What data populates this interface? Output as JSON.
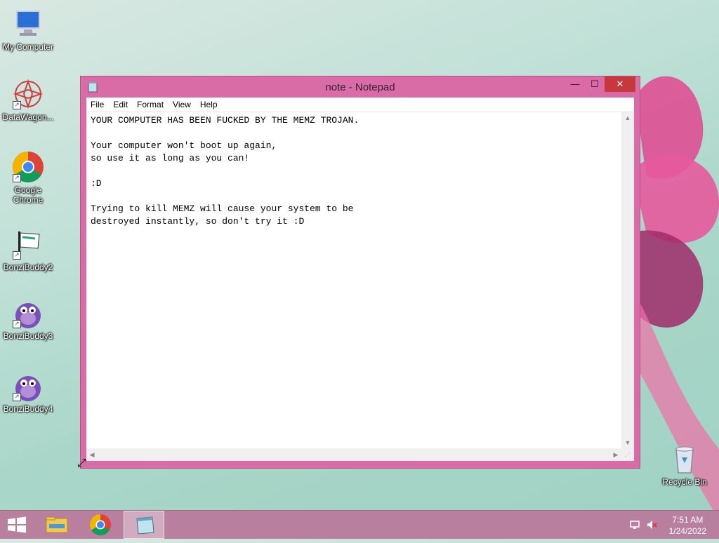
{
  "desktop": {
    "icons": [
      {
        "label": "My Computer",
        "icon": "computer-icon"
      },
      {
        "label": "DataWagon...",
        "icon": "datawagon-icon"
      },
      {
        "label": "Google Chrome",
        "icon": "chrome-icon"
      },
      {
        "label": "BonziBuddy2",
        "icon": "bonzi-flag-icon"
      },
      {
        "label": "BonziBuddy3",
        "icon": "bonzi-gorilla-icon"
      },
      {
        "label": "BonziBuddy4",
        "icon": "bonzi-gorilla-icon"
      },
      {
        "label": "Recycle Bin",
        "icon": "recycle-bin-icon"
      }
    ]
  },
  "window": {
    "title": "note - Notepad",
    "controls": {
      "minimize": "—",
      "maximize": "☐",
      "close": "✕"
    },
    "menu": [
      "File",
      "Edit",
      "Format",
      "View",
      "Help"
    ],
    "content": "YOUR COMPUTER HAS BEEN FUCKED BY THE MEMZ TROJAN.\n\nYour computer won't boot up again,\nso use it as long as you can!\n\n:D\n\nTrying to kill MEMZ will cause your system to be\ndestroyed instantly, so don't try it :D"
  },
  "taskbar": {
    "items": [
      "start-icon",
      "file-explorer-icon",
      "chrome-icon",
      "notepad-icon"
    ],
    "clock": {
      "time": "7:51 AM",
      "date": "1/24/2022"
    }
  },
  "colors": {
    "window_frame": "#d96ca6",
    "taskbar": "#b87f9f",
    "close_button": "#c7383d"
  }
}
